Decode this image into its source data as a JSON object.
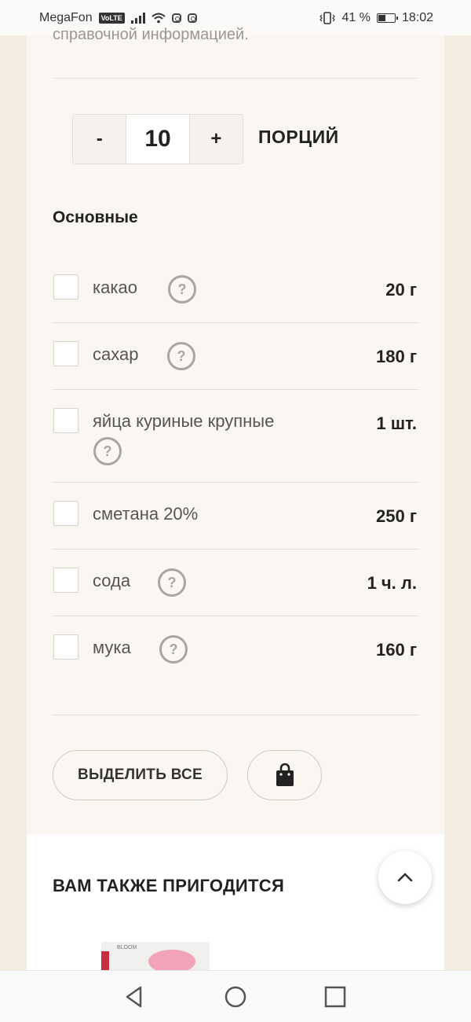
{
  "status_bar": {
    "carrier": "MegaFon",
    "volte": "VoLTE",
    "battery_percent": "41 %",
    "time": "18:02"
  },
  "card": {
    "cut_off_text": "справочной информацией.",
    "servings": {
      "minus_label": "-",
      "value": "10",
      "plus_label": "+",
      "unit_label": "ПОРЦИЙ"
    },
    "section_title": "Основные",
    "ingredients": [
      {
        "name": "какао",
        "amount": "20 г"
      },
      {
        "name": "сахар",
        "amount": "180 г"
      },
      {
        "name": "яйца куриные крупные",
        "amount": "1 шт."
      },
      {
        "name": "сметана 20%",
        "amount": "250 г"
      },
      {
        "name": "сода",
        "amount": "1 ч. л."
      },
      {
        "name": "мука",
        "amount": "160 г"
      }
    ],
    "help_glyph": "?",
    "select_all_label": "ВЫДЕЛИТЬ ВСЕ"
  },
  "also_section": {
    "title": "ВАМ ТАКЖЕ ПРИГОДИТСЯ",
    "product_label": "BLOOM"
  },
  "colors": {
    "page_bg": "#f3ece0",
    "card_bg": "#faf7f3",
    "text": "#222222",
    "muted": "#a9a5a0"
  }
}
